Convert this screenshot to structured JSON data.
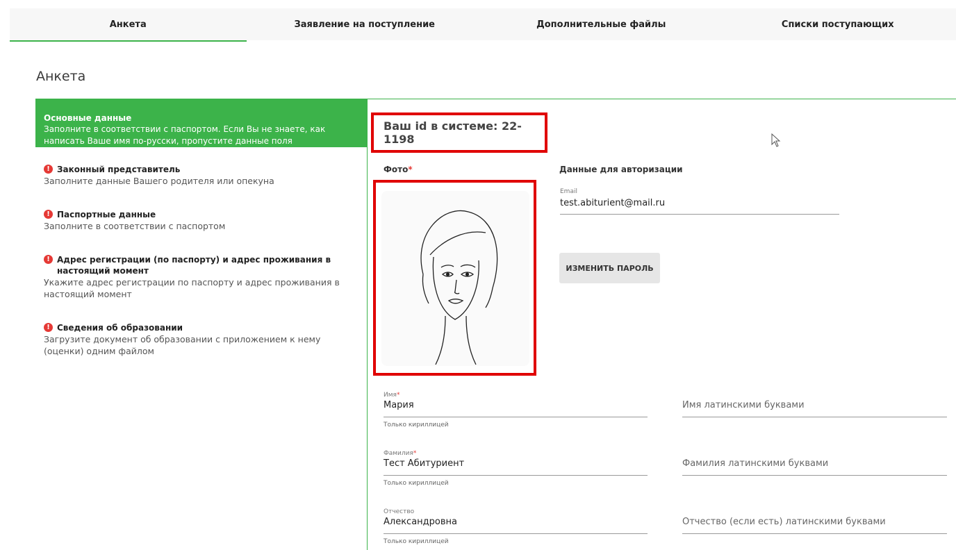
{
  "tabs": [
    "Анкета",
    "Заявление на поступление",
    "Дополнительные файлы",
    "Списки поступающих"
  ],
  "page_title": "Анкета",
  "sidebar": [
    {
      "title": "Основные данные",
      "desc": "Заполните в соответствии с паспортом. Если Вы не знаете, как написать Ваше имя по-русски, пропустите данные поля"
    },
    {
      "title": "Законный представитель",
      "desc": "Заполните данные Вашего родителя или опекуна"
    },
    {
      "title": "Паспортные данные",
      "desc": "Заполните в соответствии с паспортом"
    },
    {
      "title": "Адрес регистрации (по паспорту) и адрес проживания в настоящий момент",
      "desc": "Укажите адрес регистрации по паспорту и адрес проживания в настоящий момент"
    },
    {
      "title": "Сведения об образовании",
      "desc": "Загрузите документ об образовании с приложением к нему (оценки) одним файлом"
    }
  ],
  "warn_glyph": "!",
  "system_id": "Ваш id в системе: 22-1198",
  "photo_label": "Фото",
  "req_mark": "*",
  "auth_title": "Данные для авторизации",
  "email_label": "Email",
  "email_value": "test.abiturient@mail.ru",
  "change_password": "ИЗМЕНИТЬ ПАРОЛЬ",
  "fields": {
    "first_name": {
      "label": "Имя",
      "value": "Мария",
      "hint": "Только кириллицей",
      "latin_placeholder": "Имя латинскими буквами"
    },
    "last_name": {
      "label": "Фамилия",
      "value": "Тест Абитуриент",
      "hint": "Только кириллицей",
      "latin_placeholder": "Фамилия латинскими буквами"
    },
    "patronymic": {
      "label": "Отчество",
      "value": "Александровна",
      "hint": "Только кириллицей",
      "latin_placeholder": "Отчество (если есть) латинскими буквами"
    }
  }
}
